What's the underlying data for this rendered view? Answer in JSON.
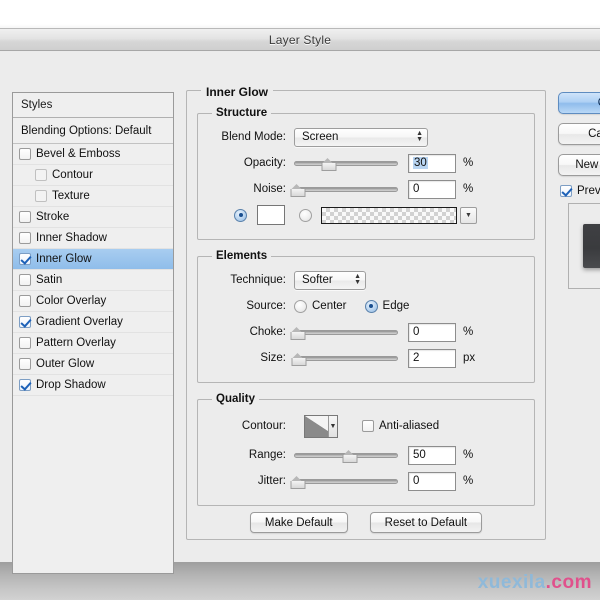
{
  "window": {
    "title": "Layer Style"
  },
  "styles_panel": {
    "header": "Styles",
    "blending_options": "Blending Options: Default",
    "items": [
      {
        "label": "Bevel & Emboss",
        "checked": false,
        "indent": false,
        "selected": false
      },
      {
        "label": "Contour",
        "checked": false,
        "indent": true,
        "selected": false
      },
      {
        "label": "Texture",
        "checked": false,
        "indent": true,
        "selected": false
      },
      {
        "label": "Stroke",
        "checked": false,
        "indent": false,
        "selected": false
      },
      {
        "label": "Inner Shadow",
        "checked": false,
        "indent": false,
        "selected": false
      },
      {
        "label": "Inner Glow",
        "checked": true,
        "indent": false,
        "selected": true
      },
      {
        "label": "Satin",
        "checked": false,
        "indent": false,
        "selected": false
      },
      {
        "label": "Color Overlay",
        "checked": false,
        "indent": false,
        "selected": false
      },
      {
        "label": "Gradient Overlay",
        "checked": true,
        "indent": false,
        "selected": false
      },
      {
        "label": "Pattern Overlay",
        "checked": false,
        "indent": false,
        "selected": false
      },
      {
        "label": "Outer Glow",
        "checked": false,
        "indent": false,
        "selected": false
      },
      {
        "label": "Drop Shadow",
        "checked": true,
        "indent": false,
        "selected": false
      }
    ]
  },
  "panel": {
    "title": "Inner Glow",
    "structure": {
      "legend": "Structure",
      "blend_mode_label": "Blend Mode:",
      "blend_mode_value": "Screen",
      "opacity_label": "Opacity:",
      "opacity_value": "30",
      "opacity_unit": "%",
      "opacity_percent": 30,
      "noise_label": "Noise:",
      "noise_value": "0",
      "noise_unit": "%",
      "noise_percent": 0,
      "fill_color_selected": true,
      "fill_color_hex": "#ffffff",
      "fill_gradient_selected": false
    },
    "elements": {
      "legend": "Elements",
      "technique_label": "Technique:",
      "technique_value": "Softer",
      "source_label": "Source:",
      "source_center_label": "Center",
      "source_edge_label": "Edge",
      "source_selected": "Edge",
      "choke_label": "Choke:",
      "choke_value": "0",
      "choke_unit": "%",
      "choke_percent": 0,
      "size_label": "Size:",
      "size_value": "2",
      "size_unit": "px",
      "size_percent": 1
    },
    "quality": {
      "legend": "Quality",
      "contour_label": "Contour:",
      "anti_aliased_label": "Anti-aliased",
      "anti_aliased_checked": false,
      "range_label": "Range:",
      "range_value": "50",
      "range_unit": "%",
      "range_percent": 50,
      "jitter_label": "Jitter:",
      "jitter_value": "0",
      "jitter_unit": "%",
      "jitter_percent": 0
    },
    "bottom_buttons": {
      "make_default": "Make Default",
      "reset_to_default": "Reset to Default"
    }
  },
  "actions": {
    "ok": "OK",
    "cancel": "Cancel",
    "new_style": "New Style...",
    "preview_label": "Preview",
    "preview_checked": true
  },
  "watermark": {
    "name": "xuexila",
    "tld": ".com",
    "name_color": "#8fb9d9",
    "tld_color": "#e0518c"
  }
}
